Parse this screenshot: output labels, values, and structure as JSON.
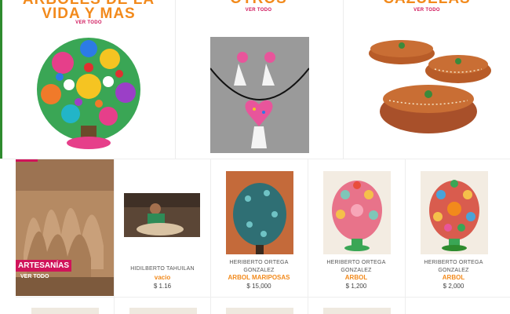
{
  "categories": [
    {
      "title_line1": "ARBOLES DE LA",
      "title_line2": "VIDA Y MAS",
      "link": "VER TODO",
      "icon": "tree-of-life-image"
    },
    {
      "title": "OTROS",
      "link": "VER TODO",
      "icon": "earrings-necklace-image"
    },
    {
      "title": "CAZUELAS",
      "link": "VER TODO",
      "icon": "clay-pots-image"
    }
  ],
  "promo": {
    "label": "ARTESANÍAS",
    "link": "VER TODO"
  },
  "products": [
    {
      "seller": "HIDILBERTO TAHUILAN",
      "name": "vacio",
      "price": "$ 1.16"
    },
    {
      "seller_line1": "HERIBERTO ORTEGA",
      "seller_line2": "GONZALEZ",
      "name": "ARBOL MARIPOSAS",
      "price": "$ 15,000"
    },
    {
      "seller_line1": "HERIBERTO ORTEGA",
      "seller_line2": "GONZALEZ",
      "name": "ARBOL",
      "price": "$ 1,200"
    },
    {
      "seller_line1": "HERIBERTO ORTEGA",
      "seller_line2": "GONZALEZ",
      "name": "ARBOL",
      "price": "$ 2,000"
    }
  ],
  "colors": {
    "accent_orange": "#f28a1c",
    "accent_pink": "#d0145a",
    "edge_green": "#2e8b2e"
  }
}
